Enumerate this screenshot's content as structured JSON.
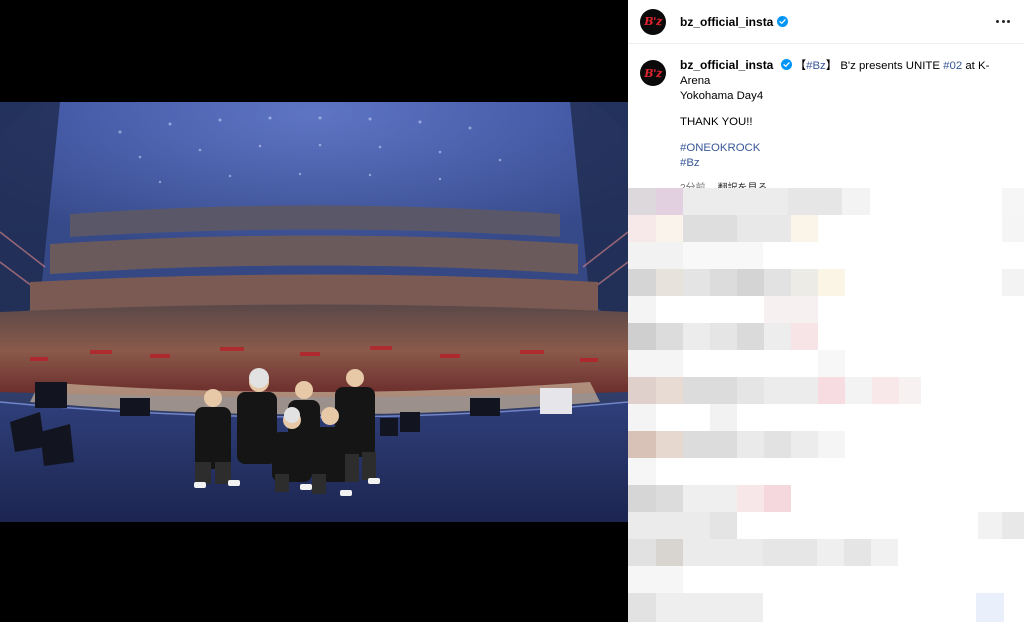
{
  "post": {
    "username": "bz_official_insta",
    "avatar_text": "B'z",
    "caption": {
      "open_bracket": "【",
      "tag_bz": "#Bz",
      "close_bracket": "】",
      "title_text": " B'z presents UNITE ",
      "tag_02": "#02",
      "venue_text": " at K-Arena",
      "line2": "Yokohama Day4",
      "thanks": "THANK YOU!!",
      "hashtag_1": "#ONEOKROCK",
      "hashtag_2": "#Bz"
    },
    "time_ago": "2分前",
    "translate_label": "翻訳を見る"
  },
  "colors": {
    "link": "#385898",
    "verified": "#0095f6",
    "brand_red": "#e0252f"
  },
  "icons": [
    "verified-badge-icon",
    "more-options-icon"
  ]
}
